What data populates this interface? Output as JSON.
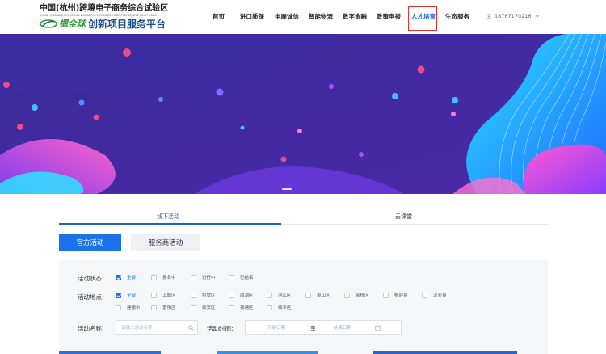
{
  "header": {
    "logo_line1": "中国(杭州)跨境电子商务综合试验区",
    "logo_line2": "CHINA (HANGZHOU) CROSS-BORDER E-COMMERCE COMPREHENSIVE PILOT AREA",
    "logo_brand": "摁全球",
    "logo_platform": "创新项目服务平台",
    "nav": [
      "首页",
      "进口质保",
      "电商诚信",
      "智能物流",
      "数字金融",
      "政策申报",
      "人才培育",
      "生态服务"
    ],
    "nav_active_index": 6,
    "user_phone": "18767170216"
  },
  "tabs": [
    "线下活动",
    "云课堂"
  ],
  "activity_types": {
    "official": "官方活动",
    "provider": "服务商活动"
  },
  "filters": {
    "status_label": "活动状态:",
    "status_options": [
      "全部",
      "报名中",
      "进行中",
      "已结束"
    ],
    "location_label": "活动地点:",
    "location_options_row1": [
      "全部",
      "上城区",
      "拱墅区",
      "西湖区",
      "滨江区",
      "萧山区",
      "余杭区",
      "桐庐县",
      "淳安县"
    ],
    "location_options_row2": [
      "建德市",
      "富阳区",
      "临安区",
      "钱塘区",
      "临平区"
    ],
    "name_label": "活动名称:",
    "name_placeholder": "请输入活动名称",
    "time_label": "活动时间:",
    "start_placeholder": "开始日期",
    "range_sep": "至",
    "end_placeholder": "结束日期"
  },
  "colors": {
    "accent": "#1a73e8",
    "banner_bg": "#3d2b9e",
    "highlight_box": "#e23030"
  }
}
